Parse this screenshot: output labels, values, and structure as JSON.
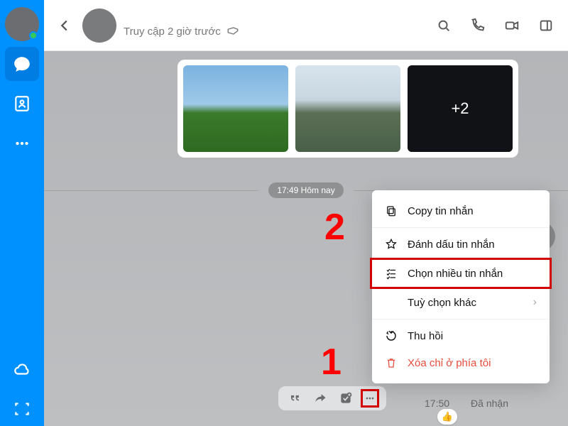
{
  "rail": {
    "items": [
      "chat",
      "contacts",
      "more",
      "cloud",
      "capture"
    ]
  },
  "header": {
    "status_text": "Truy cập 2 giờ trước",
    "actions": [
      "search",
      "call",
      "video",
      "panel"
    ]
  },
  "chat": {
    "media_overlay": "+2",
    "time_divider": "17:49 Hôm nay",
    "message_time": "17:50",
    "message_status": "Đã nhận"
  },
  "context_menu": {
    "copy": "Copy tin nhắn",
    "star": "Đánh dấu tin nhắn",
    "multiselect": "Chọn nhiều tin nhắn",
    "more_options": "Tuỳ chọn khác",
    "recall": "Thu hồi",
    "delete_me": "Xóa chỉ ở phía tôi"
  },
  "annotations": {
    "one": "1",
    "two": "2"
  }
}
